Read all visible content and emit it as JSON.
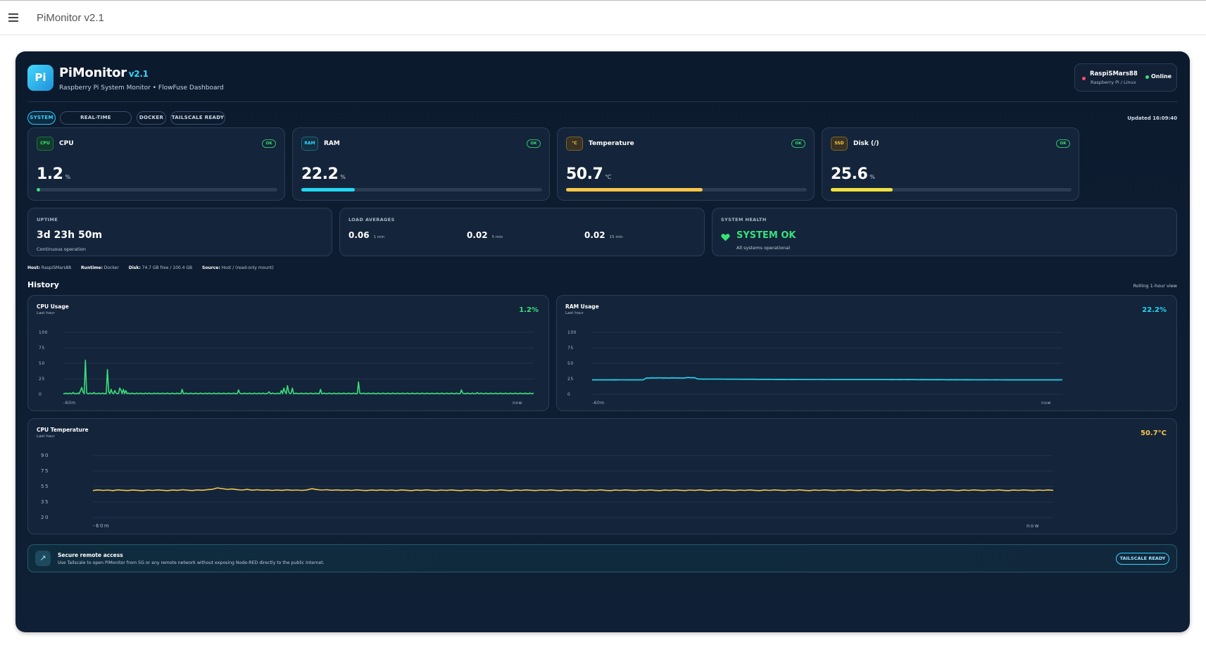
{
  "app_bar": {
    "title": "PiMonitor v2.1",
    "menu_icon": "hamburger-menu-icon"
  },
  "header": {
    "logo_text": "Pi",
    "brand": "PiMonitor",
    "version": "v2.1",
    "subtitle": "Raspberry Pi System Monitor • FlowFuse Dashboard",
    "host_name": "RaspiSMars88",
    "host_os": "Raspberry Pi / Linux",
    "status": "Online",
    "status_color": "#39e07a",
    "host_dot_color": "#ff4d6d"
  },
  "tabs": [
    {
      "label": "SYSTEM",
      "active": true
    },
    {
      "label": "REAL-TIME MONITORING",
      "active": false
    },
    {
      "label": "DOCKER",
      "active": false
    },
    {
      "label": "TAILSCALE READY",
      "active": false
    }
  ],
  "updated": "Updated 16:09:40",
  "kpis": [
    {
      "badge": "CPU",
      "label": "CPU",
      "value": "1.2",
      "unit": "%",
      "status": "OK",
      "percent": 1.2,
      "color": "#39e07a",
      "badge_color": "#39e07a",
      "badge_bg": "#123a2a"
    },
    {
      "badge": "RAM",
      "label": "RAM",
      "value": "22.2",
      "unit": "%",
      "status": "OK",
      "percent": 22.2,
      "color": "#22d8f0",
      "badge_color": "#35d2ff",
      "badge_bg": "#123043"
    },
    {
      "badge": "°C",
      "label": "Temperature",
      "value": "50.7",
      "unit": "°C",
      "status": "OK",
      "percent": 56.7,
      "color": "#f6c74a",
      "badge_color": "#f6c74a",
      "badge_bg": "#3a3222"
    },
    {
      "badge": "SSD",
      "label": "Disk (/)",
      "value": "25.6",
      "unit": "%",
      "status": "OK",
      "percent": 25.6,
      "color": "#f0e040",
      "badge_color": "#f6c74a",
      "badge_bg": "#3a3222"
    }
  ],
  "uptime": {
    "heading": "UPTIME",
    "value": "3d 23h 50m",
    "sub": "Continuous operation"
  },
  "load": {
    "heading": "LOAD AVERAGES",
    "items": [
      {
        "value": "0.06",
        "label": "1 min"
      },
      {
        "value": "0.02",
        "label": "5 min"
      },
      {
        "value": "0.02",
        "label": "15 min"
      }
    ]
  },
  "health": {
    "heading": "SYSTEM HEALTH",
    "value": "SYSTEM OK",
    "sub": "All systems operational",
    "icon": "heart-icon"
  },
  "meta": {
    "host_k": "Host:",
    "host_v": "RaspiSMars88",
    "runtime_k": "Runtime:",
    "runtime_v": "Docker",
    "disk_k": "Disk:",
    "disk_v": "74.7 GB free / 100.4 GB",
    "source_k": "Source:",
    "source_v": "Host / (read-only mount)"
  },
  "history": {
    "title": "History",
    "note": "Rolling 1-hour view"
  },
  "charts": {
    "cpu": {
      "title": "CPU Usage",
      "sub": "Last hour",
      "current": "1.2%",
      "color": "#39e07a",
      "x_start": "-60m",
      "x_end": "now"
    },
    "ram": {
      "title": "RAM Usage",
      "sub": "Last hour",
      "current": "22.2%",
      "color": "#22d8f0",
      "x_start": "-60m",
      "x_end": "now"
    },
    "temp": {
      "title": "CPU Temperature",
      "sub": "Last hour",
      "current": "50.7°C",
      "color": "#f6c74a",
      "x_start": "-60m",
      "x_end": "now"
    }
  },
  "chart_data": [
    {
      "type": "line",
      "title": "CPU Usage",
      "ylim": [
        0,
        100
      ],
      "yticks": [
        "0",
        "25",
        "50",
        "75",
        "100"
      ],
      "xticks": [
        "-60m",
        "now"
      ],
      "series": [
        {
          "values": [
            1,
            1,
            2,
            1,
            1,
            2,
            1,
            1,
            3,
            1,
            1,
            1,
            2,
            1,
            6,
            11,
            4,
            1,
            55,
            2,
            1,
            1,
            2,
            1,
            1,
            3,
            1,
            1,
            1,
            2,
            1,
            1,
            2,
            1,
            1,
            1,
            40,
            4,
            1,
            8,
            2,
            1,
            6,
            2,
            1,
            1,
            10,
            7,
            1,
            8,
            1,
            6,
            1,
            2,
            1,
            1,
            2,
            1,
            1,
            1,
            2,
            1,
            1,
            2,
            1,
            1,
            1,
            2,
            1,
            1,
            2,
            1,
            1,
            1,
            2,
            1,
            1,
            2,
            1,
            1,
            1,
            2,
            1,
            1,
            1,
            2,
            1,
            1,
            1,
            2,
            1,
            1,
            1,
            2,
            1,
            1,
            1,
            8,
            1,
            1,
            2,
            1,
            1,
            1,
            2,
            1,
            1,
            1,
            2,
            1,
            1,
            1,
            2,
            1,
            1,
            1,
            2,
            1,
            1,
            2,
            1,
            1,
            1,
            2,
            1,
            1,
            1,
            2,
            1,
            1,
            1,
            2,
            1,
            1,
            1,
            2,
            1,
            1,
            1,
            2,
            1,
            1,
            1,
            7,
            2,
            1,
            1,
            1,
            2,
            1,
            1,
            1,
            2,
            1,
            1,
            1,
            2,
            1,
            1,
            1,
            2,
            1,
            1,
            2,
            1,
            1,
            1,
            2,
            4,
            1,
            1,
            2,
            1,
            1,
            1,
            2,
            1,
            1,
            6,
            1,
            10,
            4,
            1,
            14,
            4,
            1,
            2,
            10,
            1,
            1,
            2,
            1,
            1,
            1,
            2,
            1,
            1,
            1,
            2,
            1,
            1,
            1,
            2,
            1,
            1,
            1,
            2,
            1,
            1,
            1,
            8,
            1,
            1,
            2,
            1,
            1,
            1,
            2,
            1,
            1,
            1,
            2,
            1,
            1,
            1,
            2,
            1,
            1,
            1,
            2,
            1,
            1,
            1,
            2,
            1,
            1,
            1,
            2,
            1,
            1,
            1,
            20,
            2,
            1,
            1,
            2,
            1,
            1,
            1,
            2,
            1,
            1,
            1,
            2,
            1,
            1,
            1,
            2,
            1,
            1,
            1,
            2,
            1,
            1,
            1,
            2,
            1,
            1,
            1,
            2,
            1,
            1,
            1,
            2,
            1,
            1,
            1,
            2,
            1,
            1,
            1,
            2,
            1,
            1,
            1,
            2,
            1,
            1,
            1,
            2,
            1,
            1,
            1,
            2,
            1,
            1,
            1,
            2,
            1,
            1,
            1,
            2,
            1,
            1,
            1,
            2,
            1,
            1,
            1,
            2,
            1,
            1,
            1,
            2,
            1,
            1,
            1,
            2,
            1,
            1,
            1,
            2,
            1,
            1,
            1,
            7,
            2,
            1,
            1,
            1,
            2,
            1,
            1,
            1,
            2,
            1,
            1,
            1,
            3,
            1,
            1,
            2,
            1,
            1,
            1,
            2,
            1,
            1,
            1,
            2,
            1,
            1,
            1,
            2,
            1,
            1,
            1,
            2,
            1,
            1,
            1,
            2,
            1,
            1,
            1,
            2,
            1,
            1,
            1,
            2,
            1,
            1,
            1,
            2,
            1,
            1,
            1,
            2,
            1,
            1,
            1,
            2,
            1,
            1,
            2
          ]
        }
      ]
    },
    {
      "type": "line",
      "title": "RAM Usage",
      "ylim": [
        0,
        100
      ],
      "yticks": [
        "0",
        "25",
        "50",
        "75",
        "100"
      ],
      "xticks": [
        "-60m",
        "now"
      ],
      "series": [
        {
          "values": [
            23.2,
            23.3,
            23.2,
            23.3,
            23.2,
            23.3,
            23.2,
            23.4,
            23.2,
            23.3,
            23.3,
            23.2,
            23.3,
            23.2,
            23.3,
            23.2,
            23.3,
            26.5,
            26.3,
            26.6,
            26.4,
            26.7,
            26.4,
            26.5,
            26.3,
            26.6,
            26.4,
            26.5,
            26.3,
            26.5,
            27.2,
            26.6,
            26.9,
            24.8,
            24.5,
            24.6,
            24.5,
            24.4,
            24.5,
            24.4,
            24.5,
            24.4,
            24.3,
            24.4,
            24.3,
            24.4,
            24.3,
            24.2,
            24.3,
            24.2,
            24.3,
            24.2,
            24.1,
            24.2,
            24.1,
            24.2,
            24.1,
            24.0,
            24.1,
            24.0,
            24.1,
            24.0,
            24.0,
            24.1,
            24.0,
            24.0,
            23.9,
            24.0,
            23.9,
            24.0,
            23.9,
            23.9,
            24.0,
            23.9,
            23.9,
            23.8,
            23.9,
            23.8,
            23.9,
            23.8,
            23.8,
            23.9,
            23.8,
            23.8,
            23.7,
            23.8,
            23.7,
            23.8,
            23.7,
            23.7,
            23.8,
            23.7,
            23.7,
            23.6,
            23.7,
            23.6,
            23.7,
            23.6,
            23.6,
            23.7,
            23.6,
            23.6,
            23.5,
            23.6,
            23.5,
            23.6,
            23.5,
            23.5,
            23.6,
            23.5,
            23.5,
            23.4,
            23.5,
            23.4,
            23.5,
            23.4,
            23.4,
            23.5,
            23.4,
            23.4,
            23.3,
            23.4,
            23.3,
            23.4,
            23.3,
            23.3,
            23.4,
            23.3,
            23.3,
            23.2,
            23.3,
            23.2,
            23.3,
            23.2,
            23.2,
            23.3,
            23.2,
            23.2,
            23.2,
            23.3,
            23.2,
            23.2,
            23.2,
            23.3,
            23.2,
            23.2,
            23.2,
            23.3
          ]
        }
      ]
    },
    {
      "type": "line",
      "title": "CPU Temperature",
      "ylim": [
        20,
        90
      ],
      "yticks": [
        "20",
        "35",
        "55",
        "75",
        "90"
      ],
      "xticks": [
        "-60m",
        "now"
      ],
      "series": [
        {
          "values": [
            50.5,
            51.2,
            50.6,
            51.0,
            50.4,
            51.3,
            50.8,
            50.5,
            51.1,
            50.7,
            50.3,
            51.0,
            50.6,
            51.2,
            50.8,
            50.4,
            51.1,
            50.7,
            51.4,
            50.9,
            50.5,
            51.2,
            50.8,
            51.5,
            51.9,
            53.4,
            52.6,
            51.8,
            52.3,
            51.5,
            51.0,
            51.7,
            50.9,
            51.4,
            50.8,
            51.2,
            50.6,
            51.1,
            50.7,
            51.3,
            50.8,
            51.0,
            50.6,
            51.2,
            52.5,
            51.6,
            51.0,
            51.4,
            50.8,
            51.2,
            50.7,
            51.0,
            50.6,
            51.3,
            50.8,
            50.5,
            51.1,
            50.7,
            51.2,
            50.6,
            51.0,
            50.5,
            51.2,
            50.8,
            50.4,
            51.1,
            50.7,
            51.3,
            50.8,
            50.5,
            51.0,
            50.6,
            51.2,
            50.7,
            50.4,
            51.1,
            50.6,
            51.2,
            50.8,
            50.5,
            51.0,
            50.6,
            51.3,
            50.7,
            50.4,
            51.1,
            50.6,
            51.2,
            50.8,
            50.5,
            51.0,
            50.6,
            51.2,
            50.7,
            50.4,
            51.1,
            50.6,
            51.2,
            50.8,
            50.5,
            51.0,
            50.6,
            51.3,
            50.7,
            50.4,
            51.1,
            50.6,
            51.2,
            50.8,
            50.5,
            51.0,
            50.6,
            51.2,
            50.7,
            50.4,
            51.1,
            50.6,
            51.2,
            50.8,
            50.5,
            51.0,
            50.6,
            51.3,
            50.7,
            50.4,
            51.1,
            50.6,
            51.2,
            50.8,
            50.5,
            51.0,
            50.6,
            51.2,
            50.7,
            50.4,
            51.1,
            50.6,
            51.2,
            50.8,
            50.5,
            51.0,
            50.6,
            51.3,
            50.7,
            50.4,
            51.1,
            50.6,
            51.2,
            50.8,
            50.5,
            51.0,
            50.6,
            51.2,
            50.7,
            50.4,
            51.1,
            50.6,
            51.2,
            50.8,
            50.5,
            51.0,
            50.6,
            51.3,
            50.7,
            50.4,
            51.1,
            50.6,
            51.2,
            50.8,
            50.5,
            51.0,
            50.6,
            51.2,
            50.7,
            50.4,
            51.1,
            50.6,
            51.2,
            50.8,
            50.5,
            51.0,
            50.6,
            51.3,
            50.7,
            50.4,
            51.1,
            50.6,
            51.2,
            50.8,
            50.5,
            51.0,
            50.6,
            51.2,
            50.7
          ]
        }
      ]
    }
  ],
  "remote": {
    "title": "Secure remote access",
    "sub": "Use Tailscale to open PiMonitor from 5G or any remote network without exposing Node-RED directly to the public Internet.",
    "button": "TAILSCALE READY",
    "icon": "external-link-icon"
  }
}
